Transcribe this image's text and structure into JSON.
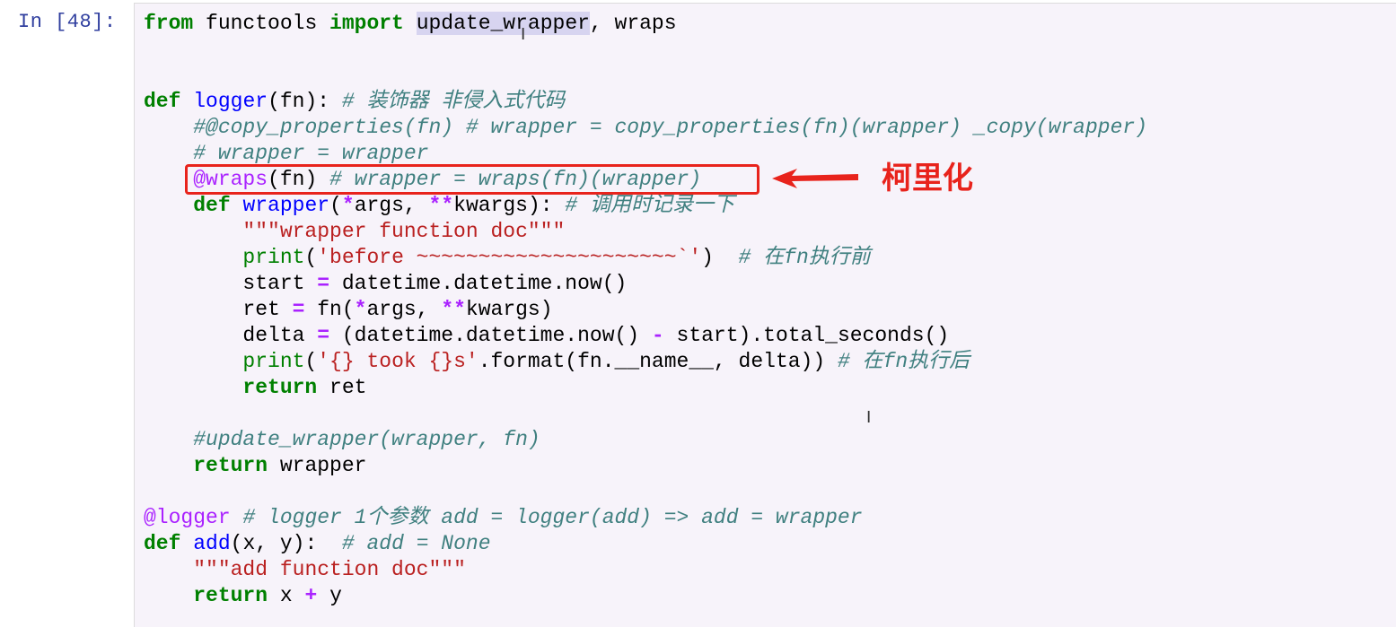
{
  "prompt": "In [48]:",
  "lines": [
    [
      [
        "from",
        "kw"
      ],
      [
        " functools ",
        ""
      ],
      [
        "import",
        "kw"
      ],
      [
        " ",
        ""
      ],
      [
        "update_wrapper",
        "hl"
      ],
      [
        ", wraps",
        ""
      ]
    ],
    [],
    [],
    [
      [
        "def",
        "kw"
      ],
      [
        " ",
        ""
      ],
      [
        "logger",
        "fn"
      ],
      [
        "(fn): ",
        ""
      ],
      [
        "# 装饰器 非侵入式代码",
        "cm"
      ]
    ],
    [
      [
        "    ",
        ""
      ],
      [
        "#@copy_properties(fn) # wrapper = copy_properties(fn)(wrapper) _copy(wrapper)",
        "cm"
      ]
    ],
    [
      [
        "    ",
        ""
      ],
      [
        "# wrapper = wrapper",
        "cm"
      ]
    ],
    [
      [
        "    ",
        ""
      ],
      [
        "@wraps",
        "dec"
      ],
      [
        "(fn) ",
        ""
      ],
      [
        "# wrapper = wraps(fn)(wrapper)",
        "cm"
      ]
    ],
    [
      [
        "    ",
        ""
      ],
      [
        "def",
        "kw"
      ],
      [
        " ",
        ""
      ],
      [
        "wrapper",
        "fn"
      ],
      [
        "(",
        ""
      ],
      [
        "*",
        "op"
      ],
      [
        "args, ",
        ""
      ],
      [
        "**",
        "op"
      ],
      [
        "kwargs): ",
        ""
      ],
      [
        "# 调用时记录一下",
        "cm"
      ]
    ],
    [
      [
        "        ",
        ""
      ],
      [
        "\"\"\"wrapper function doc\"\"\"",
        "st"
      ]
    ],
    [
      [
        "        ",
        ""
      ],
      [
        "print",
        "kw2"
      ],
      [
        "(",
        ""
      ],
      [
        "'before ~~~~~~~~~~~~~~~~~~~~~`'",
        "st"
      ],
      [
        ")  ",
        ""
      ],
      [
        "# 在fn执行前",
        "cm"
      ]
    ],
    [
      [
        "        start ",
        ""
      ],
      [
        "=",
        "op"
      ],
      [
        " datetime.datetime.now()",
        ""
      ]
    ],
    [
      [
        "        ret ",
        ""
      ],
      [
        "=",
        "op"
      ],
      [
        " fn(",
        ""
      ],
      [
        "*",
        "op"
      ],
      [
        "args, ",
        ""
      ],
      [
        "**",
        "op"
      ],
      [
        "kwargs)",
        ""
      ]
    ],
    [
      [
        "        delta ",
        ""
      ],
      [
        "=",
        "op"
      ],
      [
        " (datetime.datetime.now() ",
        ""
      ],
      [
        "-",
        "op"
      ],
      [
        " start).total_seconds()",
        ""
      ]
    ],
    [
      [
        "        ",
        ""
      ],
      [
        "print",
        "kw2"
      ],
      [
        "(",
        ""
      ],
      [
        "'{} took {}s'",
        "st"
      ],
      [
        ".format(fn.__name__, delta)) ",
        ""
      ],
      [
        "# 在fn执行后",
        "cm"
      ]
    ],
    [
      [
        "        ",
        ""
      ],
      [
        "return",
        "kw"
      ],
      [
        " ret",
        ""
      ]
    ],
    [],
    [
      [
        "    ",
        ""
      ],
      [
        "#update_wrapper(wrapper, fn)",
        "cm"
      ]
    ],
    [
      [
        "    ",
        ""
      ],
      [
        "return",
        "kw"
      ],
      [
        " wrapper",
        ""
      ]
    ],
    [],
    [
      [
        "@logger",
        "dec"
      ],
      [
        " ",
        ""
      ],
      [
        "# logger 1个参数 add = logger(add) => add = wrapper",
        "cm"
      ]
    ],
    [
      [
        "def",
        "kw"
      ],
      [
        " ",
        ""
      ],
      [
        "add",
        "fn"
      ],
      [
        "(x, y):  ",
        ""
      ],
      [
        "# add = None",
        "cm"
      ]
    ],
    [
      [
        "    ",
        ""
      ],
      [
        "\"\"\"add function doc\"\"\"",
        "st"
      ]
    ],
    [
      [
        "    ",
        ""
      ],
      [
        "return",
        "kw"
      ],
      [
        " x ",
        ""
      ],
      [
        "+",
        "op"
      ],
      [
        " y",
        ""
      ]
    ]
  ],
  "annotation": {
    "label": "柯里化",
    "color": "#e8231c"
  },
  "icons": [
    "text-cursor-icon"
  ]
}
